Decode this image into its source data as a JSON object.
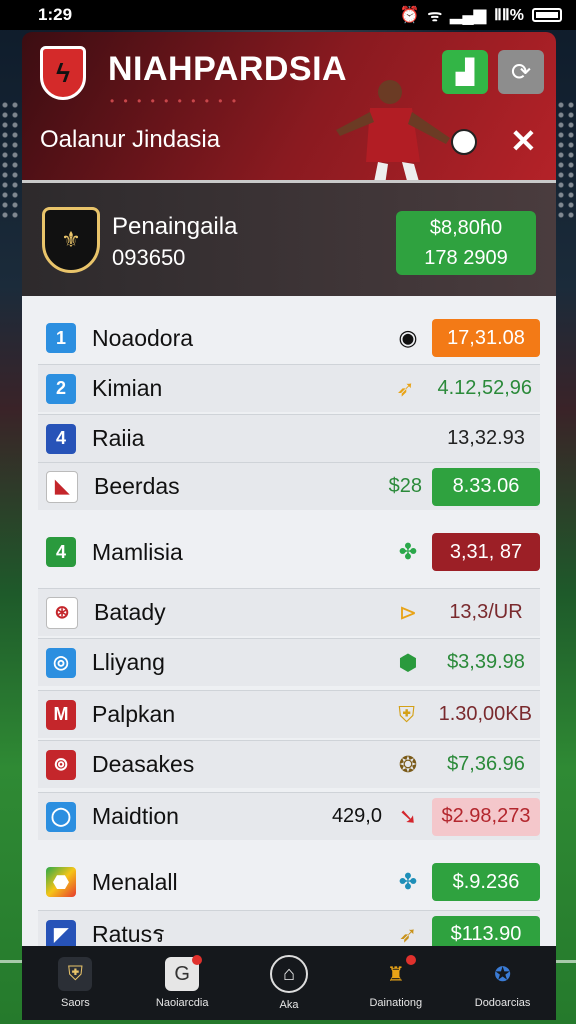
{
  "status": {
    "time": "1:29",
    "battery_text": "ⅡⅡ%"
  },
  "header": {
    "title": "NIAHPARDSIA",
    "subtitle": "Oalanur Jindasia"
  },
  "featured": {
    "name": "Penaingaila",
    "code": "093650",
    "price_line1": "$8,80ɦ0",
    "price_line2": "178 2909"
  },
  "rows": [
    {
      "badge": "1",
      "name": "Noaodora",
      "value": "17,31.08"
    },
    {
      "badge": "2",
      "name": "Kimian",
      "value": "4.12,52,96"
    },
    {
      "badge": "4",
      "name": "Raiia",
      "value": "13,32.93"
    },
    {
      "badge": "",
      "name": "Beerdas",
      "extra": "$28",
      "value": "8.33.06"
    },
    {
      "badge": "4",
      "name": "Mamlisia",
      "value": "3,31, 87"
    },
    {
      "badge": "",
      "name": "Batady",
      "value": "13,3/UR"
    },
    {
      "badge": "",
      "name": "Lliyang",
      "value": "$3,39.98"
    },
    {
      "badge": "M",
      "name": "Palpkan",
      "value": "1.30,00KB"
    },
    {
      "badge": "",
      "name": "Deasakes",
      "value": "$7,36.96"
    },
    {
      "badge": "",
      "name": "Maidtion",
      "extra": "429,0",
      "value": "$2.98,273"
    },
    {
      "badge": "",
      "name": "Menalall",
      "value": "$.9.236"
    },
    {
      "badge": "",
      "name": "Ratusร",
      "value": "$113.90"
    }
  ],
  "nav": [
    {
      "label": "Saors"
    },
    {
      "label": "Naoiarcdia"
    },
    {
      "label": "Aka"
    },
    {
      "label": "Dainationg"
    },
    {
      "label": "Dodoarcias"
    }
  ]
}
